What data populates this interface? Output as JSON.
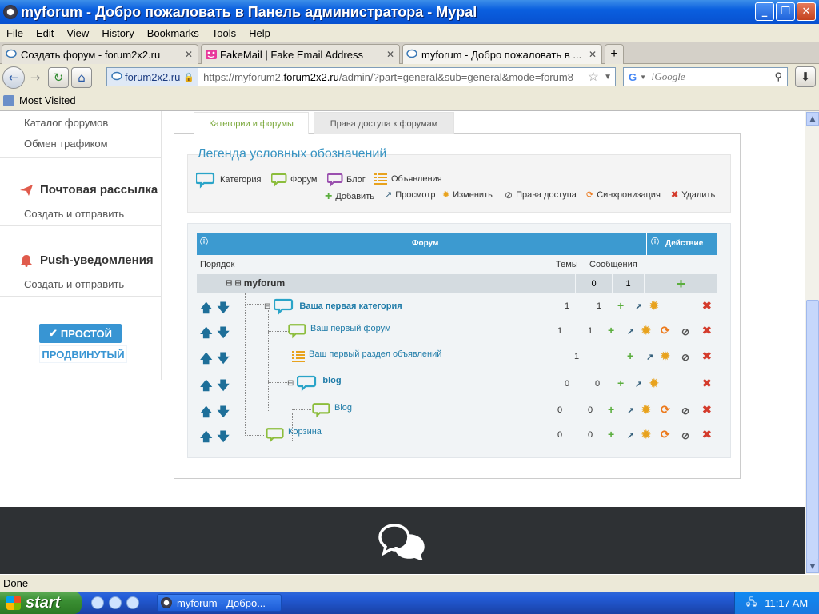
{
  "window": {
    "title": "myforum - Добро пожаловать в Панель администратора - Mypal"
  },
  "menu": [
    "File",
    "Edit",
    "View",
    "History",
    "Bookmarks",
    "Tools",
    "Help"
  ],
  "tabs": [
    {
      "label": "Создать форум - forum2x2.ru"
    },
    {
      "label": "FakeMail | Fake Email Address"
    },
    {
      "label": "myforum - Добро пожаловать в ..."
    }
  ],
  "nav": {
    "site": "forum2x2.ru",
    "url_prefix": "https://myforum2.",
    "url_domain": "forum2x2.ru",
    "url_suffix": "/admin/?part=general&sub=general&mode=forum8",
    "search_placeholder": "!Google"
  },
  "bookmarks": {
    "most_visited": "Most Visited"
  },
  "sidebar": {
    "link_catalog": "Каталог форумов",
    "link_traffic": "Обмен трафиком",
    "mailing_head": "Почтовая рассылка",
    "mailing_link": "Создать и отправить",
    "push_head": "Push-уведомления",
    "push_link": "Создать и отправить",
    "simple_btn": "ПРОСТОЙ",
    "advanced_btn": "ПРОДВИНУТЫЙ"
  },
  "panel": {
    "tab_active": "Категории и форумы",
    "tab_other": "Права доступа к форумам",
    "legend_title": "Легенда условных обозначений",
    "legend_types": [
      "Категория",
      "Форум",
      "Блог",
      "Объявления"
    ],
    "legend_actions": [
      "Добавить",
      "Просмотр",
      "Изменить",
      "Права доступа",
      "Синхронизация",
      "Удалить"
    ],
    "th_forum": "Форум",
    "th_action": "Действие",
    "col_order": "Порядок",
    "col_topics": "Темы",
    "col_messages": "Сообщения",
    "root": {
      "name": "myforum",
      "topics": "0",
      "messages": "1"
    },
    "rows": [
      {
        "name": "Ваша первая категория",
        "topics": "1",
        "messages": "1"
      },
      {
        "name": "Ваш первый форум",
        "topics": "1",
        "messages": "1"
      },
      {
        "name": "Ваш первый раздел объявлений",
        "topics": "",
        "messages": "1"
      },
      {
        "name": "blog",
        "topics": "0",
        "messages": "0"
      },
      {
        "name": "Blog",
        "topics": "0",
        "messages": "0"
      },
      {
        "name": "Корзина",
        "topics": "0",
        "messages": "0"
      }
    ]
  },
  "status": {
    "text": "Done"
  },
  "taskbar": {
    "start": "start",
    "task": "myforum - Добро...",
    "clock": "11:17 AM"
  },
  "colors": {
    "accent": "#3895d3",
    "header_blue": "#3c9ad0",
    "footer": "#2e3134"
  }
}
